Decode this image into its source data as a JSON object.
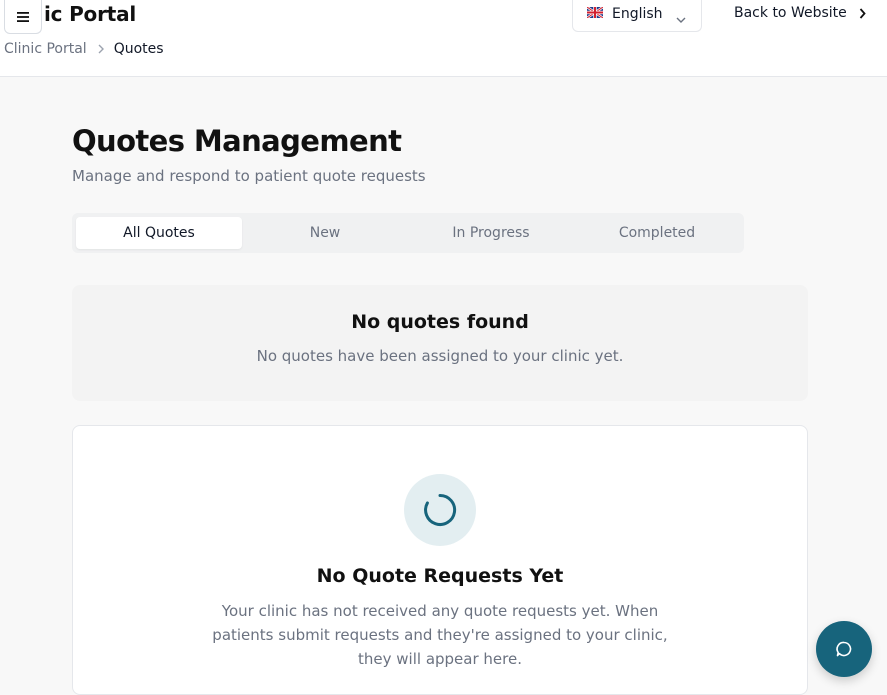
{
  "header": {
    "app_title": "ic Portal",
    "menu_icon": "hamburger-icon",
    "language": {
      "selected": "English",
      "flag_icon": "uk-flag-icon"
    },
    "back_link": "Back to Website"
  },
  "breadcrumb": {
    "items": [
      "Clinic Portal",
      "Quotes"
    ]
  },
  "page": {
    "title": "Quotes Management",
    "subtitle": "Manage and respond to patient quote requests"
  },
  "tabs": [
    {
      "label": "All Quotes",
      "active": true
    },
    {
      "label": "New",
      "active": false
    },
    {
      "label": "In Progress",
      "active": false
    },
    {
      "label": "Completed",
      "active": false
    }
  ],
  "empty_notice": {
    "title": "No quotes found",
    "text": "No quotes have been assigned to your clinic yet."
  },
  "empty_card": {
    "icon": "loading-spinner-icon",
    "title": "No Quote Requests Yet",
    "text": "Your clinic has not received any quote requests yet. When patients submit requests and they're assigned to your clinic, they will appear here."
  },
  "chat": {
    "icon": "chat-bubble-icon"
  },
  "colors": {
    "accent": "#17647c",
    "background": "#f8f8f8",
    "muted_text": "#6b7280"
  }
}
